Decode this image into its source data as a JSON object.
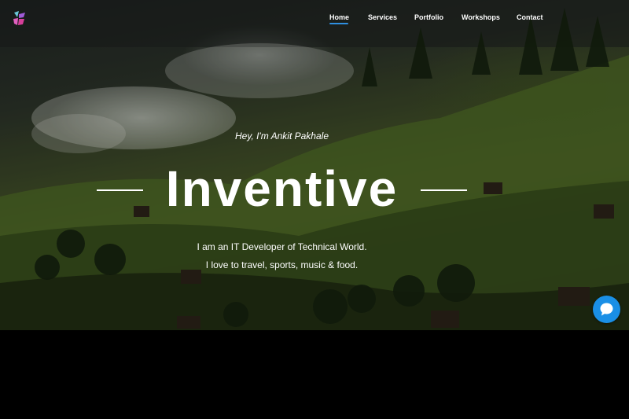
{
  "logo": {
    "icon": "logo-icon"
  },
  "nav": {
    "items": [
      {
        "label": "Home",
        "active": true
      },
      {
        "label": "Services"
      },
      {
        "label": "Portfolio"
      },
      {
        "label": "Workshops"
      },
      {
        "label": "Contact"
      }
    ]
  },
  "hero": {
    "greeting": "Hey, I'm Ankit Pakhale",
    "title": "Inventive",
    "description_line1": "I am an IT Developer of Technical World.",
    "description_line2": "I love to travel, sports, music & food."
  },
  "chat": {
    "icon": "chat-bubble-icon"
  },
  "colors": {
    "accent": "#2f8fe0",
    "chat_button": "#1a8fe6"
  }
}
